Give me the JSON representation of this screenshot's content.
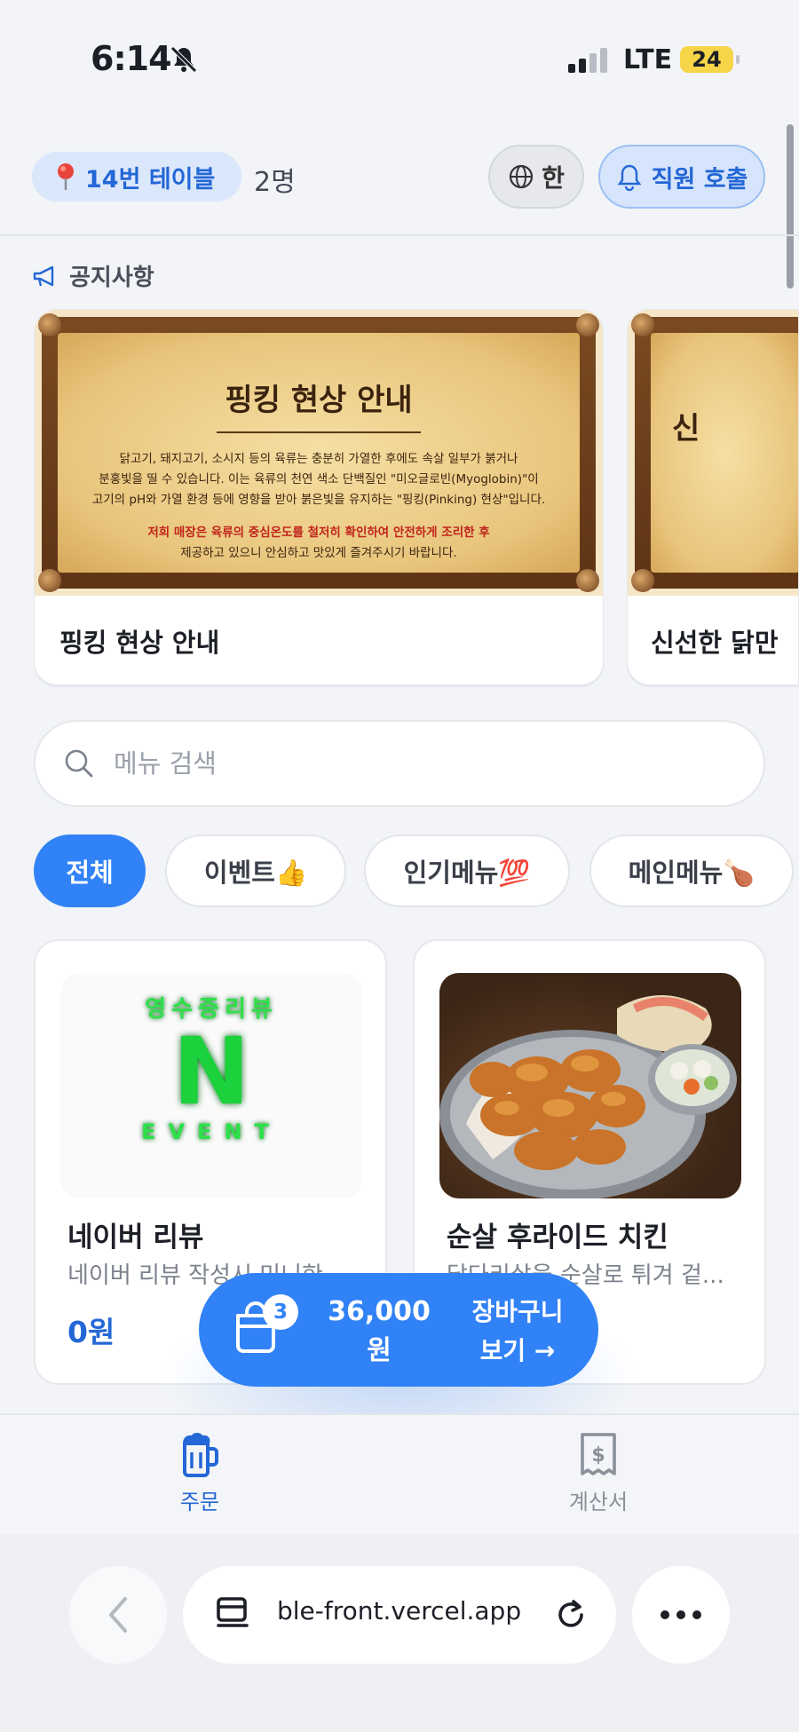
{
  "status_bar": {
    "time": "6:14",
    "network": "LTE",
    "battery": "24"
  },
  "header": {
    "table_label": "14번 테이블",
    "guest_count": "2명",
    "language_label": "한",
    "call_staff_label": "직원 호출"
  },
  "notices": {
    "section_title": "공지사항",
    "cards": [
      {
        "title": "핑킹 현상 안내",
        "image_heading": "핑킹 현상 안내",
        "image_body_1": "닭고기, 돼지고기, 소시지 등의 육류는 충분히 가열한 후에도 속살 일부가 붉거나",
        "image_body_2": "분홍빛을 띨 수 있습니다. 이는 육류의 천연 색소 단백질인 \"미오글로빈(Myoglobin)\"이",
        "image_body_3": "고기의 pH와 가열 환경 등에 영향을 받아 붉은빛을 유지하는 \"핑킹(Pinking) 현상\"입니다.",
        "image_body_4": "저희 매장은 육류의 중심온도를 철저히 확인하여 안전하게 조리한 후",
        "image_body_5": "제공하고 있으니 안심하고 맛있게 즐겨주시기 바랍니다."
      },
      {
        "title": "신선한 닭만",
        "image_heading": "신"
      }
    ]
  },
  "search": {
    "placeholder": "메뉴 검색"
  },
  "categories": [
    {
      "label": "전체"
    },
    {
      "label": "이벤트👍"
    },
    {
      "label": "인기메뉴💯"
    },
    {
      "label": "메인메뉴🍗"
    }
  ],
  "products": [
    {
      "name": "네이버 리뷰",
      "description": "네이버 리뷰 작성시 미니한...",
      "price": "0원",
      "image_top": "영수증리뷰",
      "image_big": "N",
      "image_bottom": "EVENT"
    },
    {
      "name": "순살 후라이드 치킨",
      "description": "닭다리살을 순살로 튀겨 겉...",
      "price": ""
    }
  ],
  "cart": {
    "count": "3",
    "total_amount": "36,000",
    "total_unit": "원",
    "view_line1": "장바구니",
    "view_line2": "보기 →"
  },
  "tabbar": {
    "order_label": "주문",
    "bill_label": "계산서"
  },
  "browser": {
    "url": "ble-front.vercel.app"
  },
  "colors": {
    "accent": "#3182f6",
    "accent_dark": "#2467d6"
  }
}
